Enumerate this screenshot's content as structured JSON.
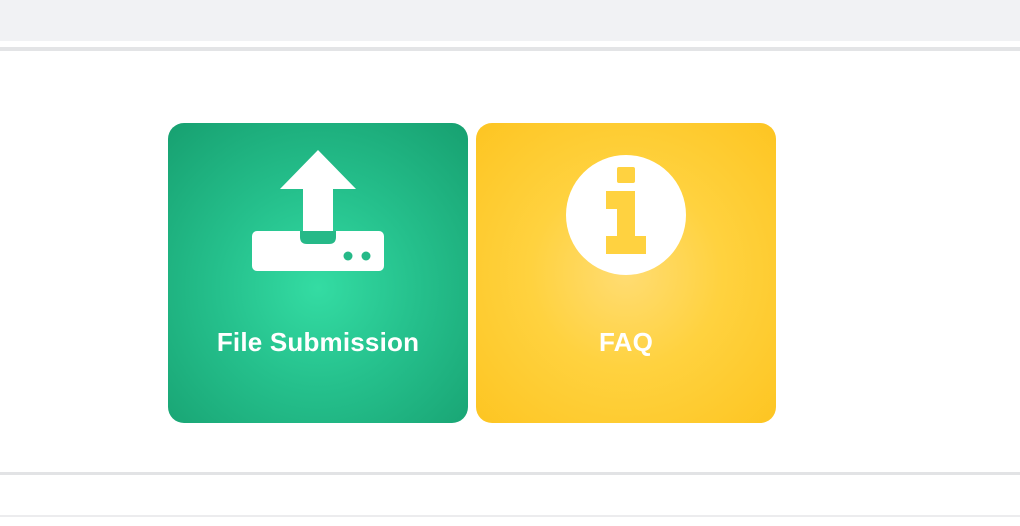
{
  "tiles": {
    "file_submission": {
      "label": "File Submission",
      "icon": "upload-icon",
      "color": "#25c08c"
    },
    "faq": {
      "label": "FAQ",
      "icon": "info-icon",
      "color": "#ffd23f"
    }
  },
  "colors": {
    "top_bar": "#f1f2f4",
    "divider": "#e3e4e6",
    "background": "#ffffff"
  }
}
